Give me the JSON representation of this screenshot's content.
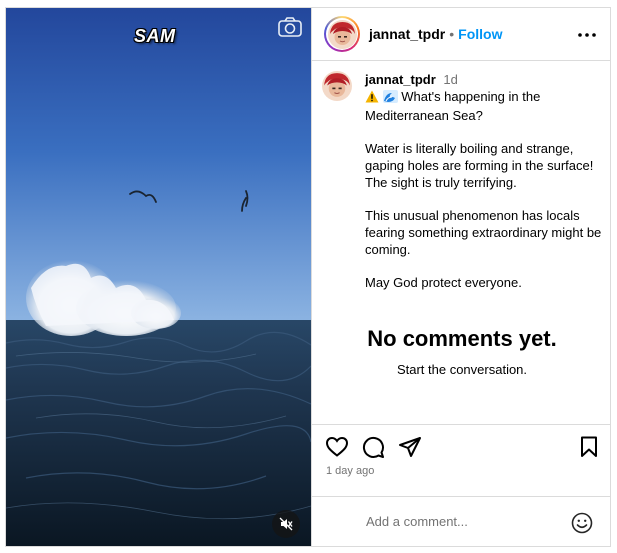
{
  "media": {
    "watermark": "SAM",
    "icons": {
      "camera": "camera-icon",
      "mute": "speaker-muted-icon"
    }
  },
  "header": {
    "username": "jannat_tpdr",
    "separator": "•",
    "follow_label": "Follow",
    "more_icon": "more-options-icon"
  },
  "caption": {
    "username": "jannat_tpdr",
    "time": "1d",
    "lines": [
      "What's happening in the Mediterranean Sea?",
      "Water is literally boiling and strange, gaping holes are forming in the surface! The sight is truly terrifying.",
      "This unusual phenomenon has locals fearing something extraordinary might be coming.",
      "May God protect everyone."
    ]
  },
  "comments": {
    "empty_title": "No comments yet.",
    "empty_subtitle": "Start the conversation."
  },
  "actions": {
    "icons": [
      "heart-icon",
      "comment-icon",
      "share-icon",
      "bookmark-icon"
    ],
    "time_ago": "1 day ago"
  },
  "comment_box": {
    "placeholder": "Add a comment...",
    "emoji_icon": "emoji-icon"
  },
  "colors": {
    "link": "#0095f6",
    "border": "#dbdbdb",
    "muted": "#737373"
  }
}
